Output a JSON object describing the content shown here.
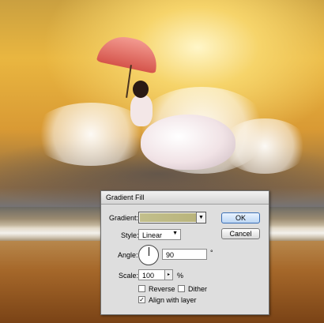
{
  "dialog": {
    "title": "Gradient Fill",
    "gradient_label": "Gradient:",
    "gradient_colors": [
      "#c2bf8c",
      "#b9b47c"
    ],
    "style_label": "Style:",
    "style_value": "Linear",
    "angle_label": "Angle:",
    "angle_value": "90",
    "angle_unit": "°",
    "scale_label": "Scale:",
    "scale_value": "100",
    "scale_unit": "%",
    "reverse_label": "Reverse",
    "reverse_checked": false,
    "dither_label": "Dither",
    "dither_checked": false,
    "align_label": "Align with layer",
    "align_checked": true,
    "ok_label": "OK",
    "cancel_label": "Cancel"
  },
  "icons": {
    "dropdown": "chevron-down-icon",
    "angle": "angle-dial-icon",
    "spin": "stepper-arrow-icon",
    "check": "checkmark-icon"
  }
}
